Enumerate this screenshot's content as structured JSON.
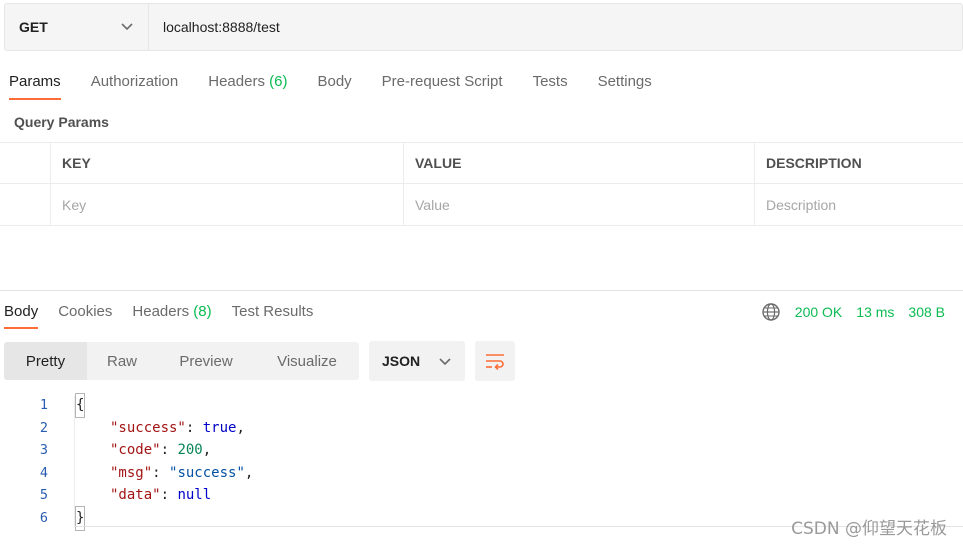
{
  "request": {
    "method": "GET",
    "url": "localhost:8888/test"
  },
  "request_tabs": [
    {
      "label": "Params",
      "active": true
    },
    {
      "label": "Authorization"
    },
    {
      "label": "Headers",
      "count": "(6)"
    },
    {
      "label": "Body"
    },
    {
      "label": "Pre-request Script"
    },
    {
      "label": "Tests"
    },
    {
      "label": "Settings"
    }
  ],
  "query_params": {
    "title": "Query Params",
    "columns": [
      "KEY",
      "VALUE",
      "DESCRIPTION"
    ],
    "placeholders": [
      "Key",
      "Value",
      "Description"
    ]
  },
  "response_tabs": [
    {
      "label": "Body",
      "active": true
    },
    {
      "label": "Cookies"
    },
    {
      "label": "Headers",
      "count": "(8)"
    },
    {
      "label": "Test Results"
    }
  ],
  "status": {
    "code": "200 OK",
    "time": "13 ms",
    "size": "308 B",
    "icon": "globe-icon"
  },
  "view_modes": [
    "Pretty",
    "Raw",
    "Preview",
    "Visualize"
  ],
  "format": "JSON",
  "code_lines": [
    {
      "num": "1",
      "text": "{"
    },
    {
      "num": "2",
      "text": "\"success\": true,"
    },
    {
      "num": "3",
      "text": "\"code\": 200,"
    },
    {
      "num": "4",
      "text": "\"msg\": \"success\","
    },
    {
      "num": "5",
      "text": "\"data\": null"
    },
    {
      "num": "6",
      "text": "}"
    }
  ],
  "code_tokens": {
    "l2": {
      "key": "\"success\"",
      "sep": ": ",
      "val": "true",
      "end": ","
    },
    "l3": {
      "key": "\"code\"",
      "sep": ": ",
      "val": "200",
      "end": ","
    },
    "l4": {
      "key": "\"msg\"",
      "sep": ": ",
      "val": "\"success\"",
      "end": ","
    },
    "l5": {
      "key": "\"data\"",
      "sep": ": ",
      "val": "null",
      "end": ""
    }
  },
  "watermark": "CSDN @仰望天花板",
  "colors": {
    "accent": "#ff6c37",
    "success": "#0cbb52"
  }
}
